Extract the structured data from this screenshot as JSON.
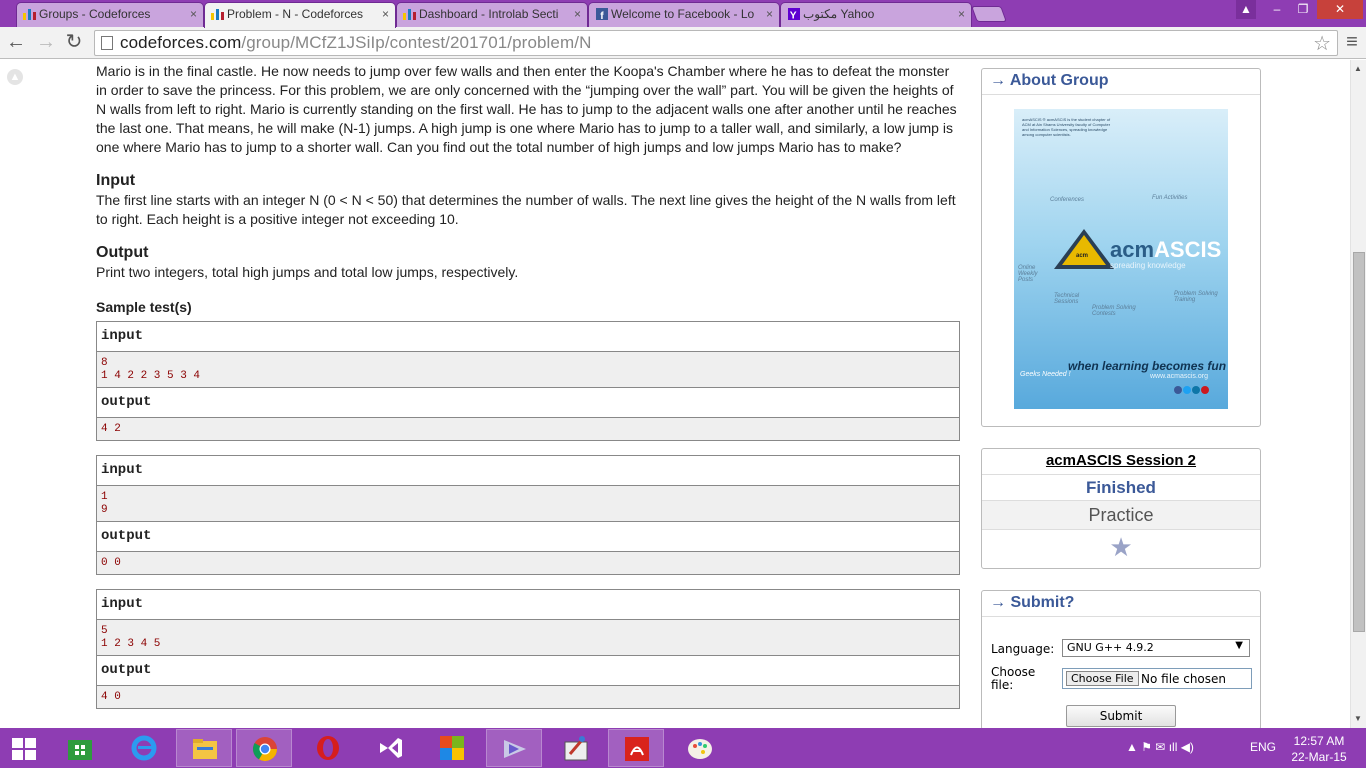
{
  "browser": {
    "tabs": [
      {
        "label": "Groups - Codeforces",
        "icon": "codeforces-icon"
      },
      {
        "label": "Problem - N - Codeforces",
        "icon": "codeforces-icon",
        "active": true
      },
      {
        "label": "Dashboard - Introlab Secti",
        "icon": "codeforces-icon"
      },
      {
        "label": "Welcome to Facebook - Lo",
        "icon": "facebook-icon"
      },
      {
        "label": "مكتوب Yahoo",
        "icon": "yahoo-icon"
      }
    ],
    "close_glyph": "×",
    "window_buttons": {
      "user": "▲",
      "minimize": "–",
      "restore": "❐",
      "close": "✕"
    },
    "nav": {
      "back": "←",
      "forward": "→",
      "reload": "↻",
      "menu": "≡",
      "star": "☆"
    },
    "url": {
      "host": "codeforces.com",
      "path": "/group/MCfZ1JSiIp/contest/201701/problem/N"
    }
  },
  "problem": {
    "statement": "Mario is in the final castle. He now needs to jump over few walls and then enter the Koopa's Chamber where he has to defeat the monster in order to save the princess. For this problem, we are only concerned with the “jumping over the wall” part. You will be given the heights of N walls from left to right. Mario is currently standing on the first wall. He has to jump to the adjacent walls one after another until he reaches the last one. That means, he will make (N-1) jumps. A high jump is one where Mario has to jump to a taller wall, and similarly, a low jump is one where Mario has to jump to a shorter wall. Can you find out the total number of high jumps and low jumps Mario has to make?",
    "input_title": "Input",
    "input_text": "The first line starts with an integer N (0 < N < 50) that determines the number of walls. The next line gives the height of the N walls from left to right. Each height is a positive integer not exceeding 10.",
    "output_title": "Output",
    "output_text": "Print two integers, total high jumps and total low jumps, respectively.",
    "sample_title": "Sample test(s)",
    "input_label": "input",
    "output_label": "output",
    "samples": [
      {
        "input": [
          "8",
          "1 4 2 2 3 5 3 4"
        ],
        "output": [
          "4 2"
        ]
      },
      {
        "input": [
          "1",
          "9"
        ],
        "output": [
          "0 0"
        ]
      },
      {
        "input": [
          "5",
          "1 2 3 4 5"
        ],
        "output": [
          "4 0"
        ]
      }
    ]
  },
  "sidebar": {
    "about_title": "→ About Group",
    "poster": {
      "brand_acm": "acm",
      "brand_rest": "ASCIS",
      "tagline": "spreading knowledge",
      "slogan": "when learning becomes fun",
      "site": "www.acmascis.org",
      "geeks": "Geeks Needed !",
      "blurb": "acmASCIS ® acmASCIS is the student chapter of ACM at Ain Shams University faculty of Computer and Information Sciences, spreading knowledge among computer scientists.",
      "labels": {
        "conferences": "Conferences",
        "fun": "Fun Activities",
        "weekly": "Online Weekly Posts",
        "technical": "Technical Sessions",
        "contests": "Problem Solving Contests",
        "training": "Problem Solving Training"
      },
      "badge": "acm"
    },
    "contest": {
      "name": "acmASCIS Session 2",
      "phase": "Finished",
      "practice": "Practice",
      "star": "★"
    },
    "submit": {
      "title": "→ Submit?",
      "language_label": "Language:",
      "language_value": "GNU G++ 4.9.2",
      "file_label": "Choose file:",
      "choose_button": "Choose File",
      "no_file": "No file chosen",
      "submit_button": "Submit"
    }
  },
  "taskbar": {
    "tray": {
      "lang": "ENG",
      "icons": "▲  ⚑  ✉  ıll  ◀)"
    },
    "clock": {
      "time": "12:57 AM",
      "date": "22-Mar-15"
    }
  }
}
